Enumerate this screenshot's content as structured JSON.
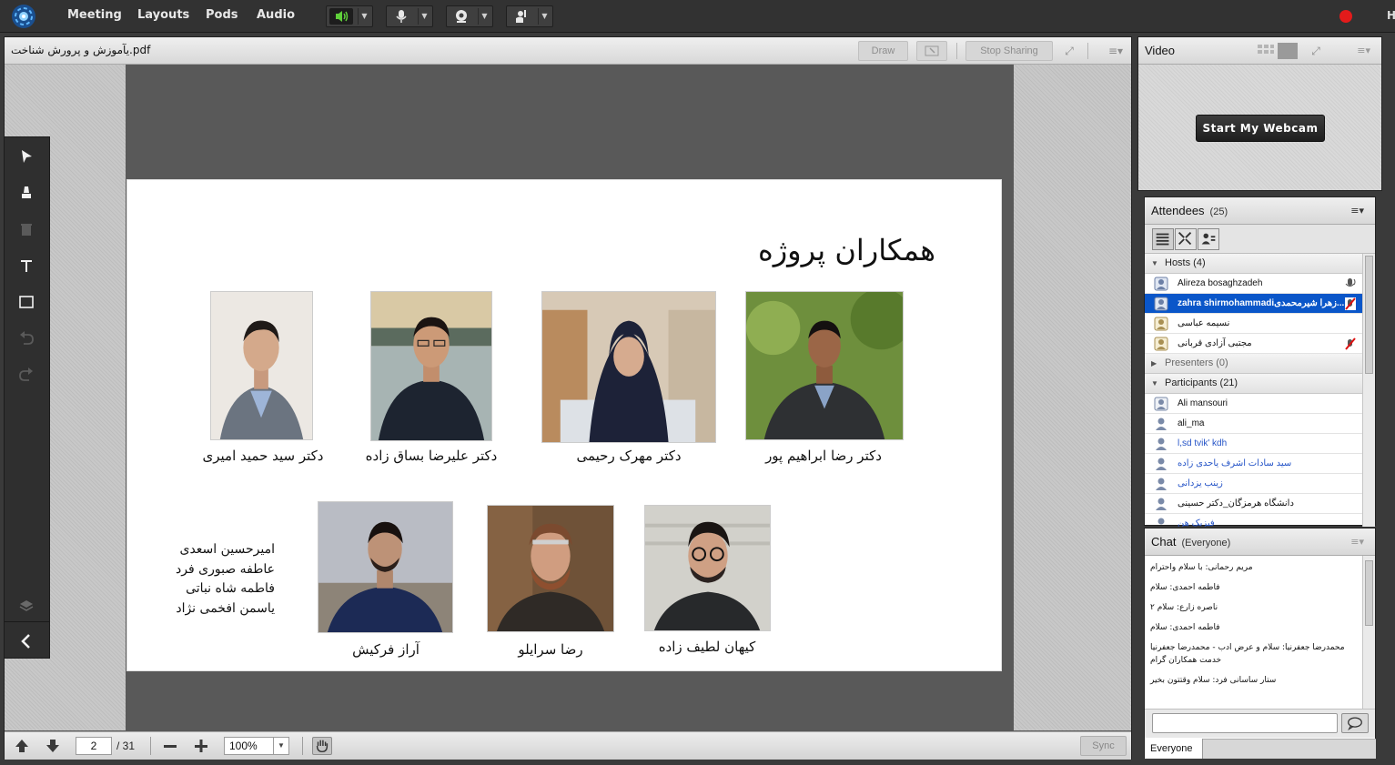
{
  "menu": {
    "items": [
      {
        "label": "Meeting"
      },
      {
        "label": "Layouts"
      },
      {
        "label": "Pods"
      },
      {
        "label": "Audio"
      }
    ],
    "right_letter": "H"
  },
  "share_pod": {
    "title": "یآموزش و پرورش شناخت.pdf",
    "draw_label": "Draw",
    "stop_sharing_label": "Stop Sharing",
    "menu_glyph": "≡▾"
  },
  "slide": {
    "title": "همکاران پروژه",
    "people_row1": [
      {
        "caption": "دکتر سید حمید امیری"
      },
      {
        "caption": "دکتر علیرضا بساق زاده"
      },
      {
        "caption": "دکتر مهرک رحیمی"
      },
      {
        "caption": "دکتر رضا ابراهیم پور"
      }
    ],
    "people_row2": [
      {
        "caption": "آراز فرکیش"
      },
      {
        "caption": "رضا سرایلو"
      },
      {
        "caption": "کیهان لطیف زاده"
      }
    ],
    "names_list": [
      "امیرحسین اسعدی",
      "عاطفه صبوری فرد",
      "فاطمه شاه نباتی",
      "یاسمن افخمی نژاد"
    ]
  },
  "footer": {
    "page": "2",
    "total": "/ 31",
    "zoom": "100%",
    "sync_label": "Sync"
  },
  "video_pod": {
    "title": "Video",
    "webcam_button": "Start My Webcam",
    "menu_glyph": "≡▾"
  },
  "attendees": {
    "title": "Attendees",
    "count": "(25)",
    "menu_glyph": "≡▾",
    "groups": {
      "hosts": "Hosts (4)",
      "presenters": "Presenters (0)",
      "participants": "Participants (21)"
    },
    "hosts": [
      {
        "name": "Alireza bosaghzadeh"
      },
      {
        "name": "zahra shirmohammadiزهرا شیرمحمدی..."
      },
      {
        "name": "نسیمه عباسی"
      },
      {
        "name": "مجتبی آزادی قربانی"
      }
    ],
    "participants": [
      {
        "name": "Ali mansouri"
      },
      {
        "name": "ali_ma"
      },
      {
        "name": "l,sd tvik' kdh"
      },
      {
        "name": "سید سادات اشرف یاحدی زاده"
      },
      {
        "name": "زینب یزدانی"
      },
      {
        "name": "دانشگاه هرمزگان_دکتر حسینی"
      },
      {
        "name": "فیزیک هن"
      }
    ]
  },
  "chat": {
    "title": "Chat",
    "scope": "(Everyone)",
    "menu_glyph": "≡▾",
    "messages": [
      "مریم رحمانی: با سلام واحترام",
      "فاطمه احمدی: سلام",
      "ناصره زارع: سلام ۲",
      "فاطمه احمدی: سلام",
      "محمدرضا جعفرنیا: سلام و عرض ادب - محمدرضا جعفرنیا خدمت همکاران گرام",
      "ستار ساسانی فرد: سلام وقتتون بخیر"
    ],
    "tab_label": "Everyone"
  }
}
